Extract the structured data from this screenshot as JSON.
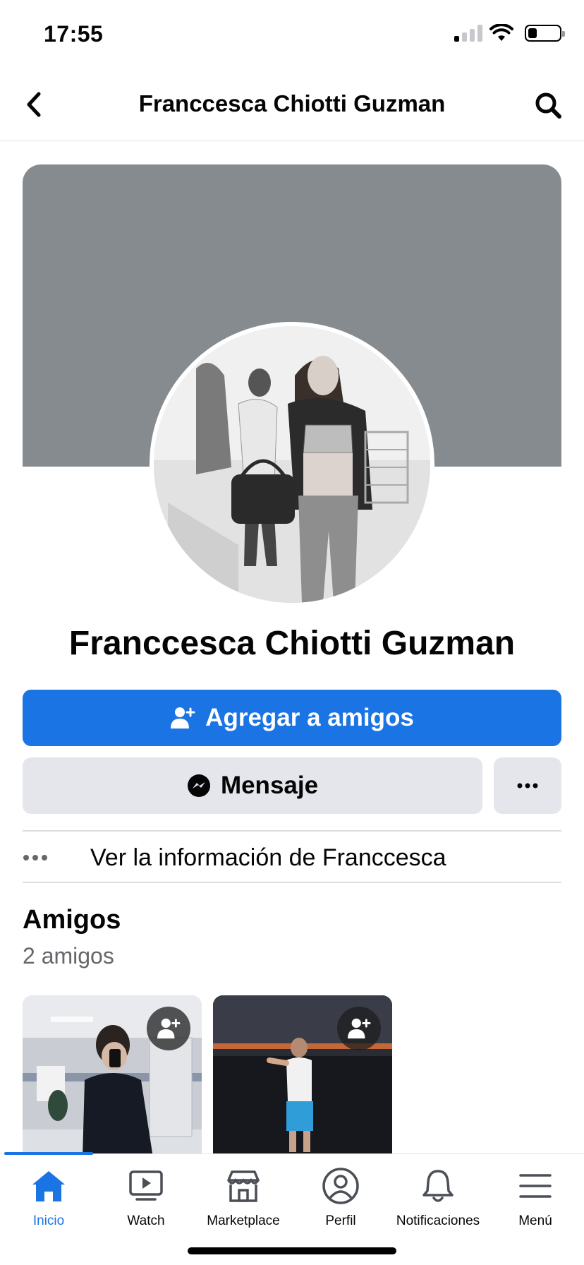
{
  "status_bar": {
    "time": "17:55",
    "icons": [
      "cellular-signal-icon",
      "wifi-icon",
      "battery-icon"
    ],
    "battery_level": 0.25
  },
  "header": {
    "back_icon": "chevron-left-icon",
    "title": "Franccesca Chiotti Guzman",
    "search_icon": "search-icon"
  },
  "profile": {
    "cover_color": "#868b8f",
    "name": "Franccesca Chiotti Guzman"
  },
  "actions": {
    "add_friend_label": "Agregar a amigos",
    "add_friend_icon": "add-friend-icon",
    "message_label": "Mensaje",
    "message_icon": "messenger-icon",
    "more_icon": "more-horizontal-icon"
  },
  "info": {
    "label": "Ver la información de Franccesca",
    "icon": "more-dots-icon"
  },
  "friends": {
    "title": "Amigos",
    "count": "2 amigos",
    "items": [
      {
        "photo_icon": "friend-photo",
        "badge_icon": "add-friend-icon"
      },
      {
        "photo_icon": "friend-photo",
        "badge_icon": "add-friend-icon"
      }
    ]
  },
  "bottom_nav": {
    "items": [
      {
        "label": "Inicio",
        "icon": "home-icon",
        "active": true
      },
      {
        "label": "Watch",
        "icon": "watch-icon",
        "active": false
      },
      {
        "label": "Marketplace",
        "icon": "marketplace-icon",
        "active": false
      },
      {
        "label": "Perfil",
        "icon": "profile-icon",
        "active": false
      },
      {
        "label": "Notificaciones",
        "icon": "bell-icon",
        "active": false
      },
      {
        "label": "Menú",
        "icon": "menu-icon",
        "active": false
      }
    ]
  },
  "colors": {
    "accent": "#1b74e4",
    "secondary_button": "#e4e6eb",
    "muted_text": "#65676b"
  }
}
